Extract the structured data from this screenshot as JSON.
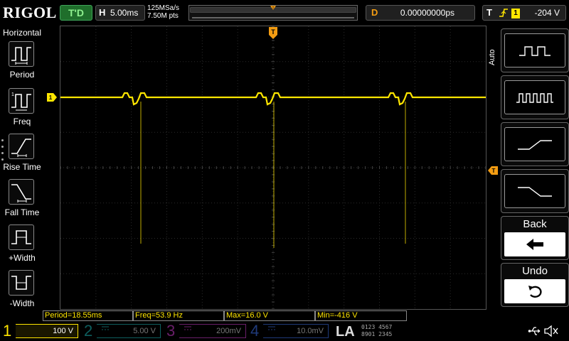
{
  "brand": "RIGOL",
  "top": {
    "run_status": "T'D",
    "timebase_label": "H",
    "timebase_value": "5.00ms",
    "sample_rate": "125MSa/s",
    "memory_depth": "7.50M pts",
    "delay_label": "D",
    "delay_value": "0.00000000ps",
    "trigger_label": "T",
    "trigger_source": "1",
    "trigger_level": "-204 V",
    "colors": {
      "run_bg": "#1f6e2b",
      "delay": "#f39c12",
      "trigger": "#ffe600"
    }
  },
  "left_menu": {
    "title": "Horizontal",
    "items": [
      {
        "label": "Period",
        "icon": "period-icon"
      },
      {
        "label": "Freq",
        "icon": "freq-icon"
      },
      {
        "label": "Rise Time",
        "icon": "rise-time-icon"
      },
      {
        "label": "Fall Time",
        "icon": "fall-time-icon"
      },
      {
        "label": "+Width",
        "icon": "positive-width-icon"
      },
      {
        "label": "-Width",
        "icon": "negative-width-icon"
      }
    ]
  },
  "right_menu": {
    "mode_label": "Auto",
    "softkeys": [
      {
        "icon": "single-pulse-wave-icon"
      },
      {
        "icon": "multi-pulse-wave-icon"
      },
      {
        "icon": "rising-edge-wave-icon"
      },
      {
        "icon": "falling-edge-wave-icon"
      },
      {
        "label": "Back",
        "icon": "arrow-left-icon"
      },
      {
        "label": "Undo",
        "icon": "undo-icon"
      }
    ]
  },
  "measurements": [
    {
      "text": "Period=18.55ms"
    },
    {
      "text": "Freq=53.9 Hz"
    },
    {
      "text": "Max=16.0 V"
    },
    {
      "text": "Min=-416 V"
    }
  ],
  "channels": [
    {
      "number": "1",
      "scale": "100 V",
      "color": "#ffe600",
      "active": true
    },
    {
      "number": "2",
      "scale": "5.00 V",
      "color": "#19c6c6",
      "active": false
    },
    {
      "number": "3",
      "scale": "200mV",
      "color": "#d63ad6",
      "active": false
    },
    {
      "number": "4",
      "scale": "10.0mV",
      "color": "#3a6cf0",
      "active": false
    }
  ],
  "la": {
    "label": "LA",
    "digits_row1": "0123 4567",
    "digits_row2": "8901 2345"
  },
  "trace": {
    "color": "#ffe600",
    "channel_marker": "1"
  }
}
